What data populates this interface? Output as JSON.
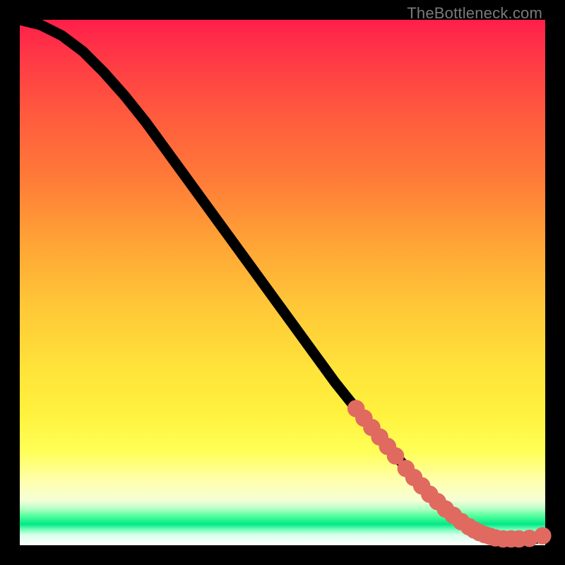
{
  "watermark": "TheBottleneck.com",
  "colors": {
    "marker": "#e06a60",
    "curve": "#000000",
    "background": "#000000"
  },
  "chart_data": {
    "type": "line",
    "title": "",
    "xlabel": "",
    "ylabel": "",
    "xlim": [
      0,
      100
    ],
    "ylim": [
      0,
      100
    ],
    "grid": false,
    "legend": false,
    "series": [
      {
        "name": "curve",
        "x": [
          0,
          4,
          8,
          12,
          16,
          20,
          24,
          28,
          32,
          36,
          40,
          44,
          48,
          52,
          56,
          60,
          64,
          68,
          72,
          76,
          80,
          83,
          85,
          88,
          90,
          92,
          94,
          96,
          98,
          100
        ],
        "y": [
          100,
          99,
          97,
          94,
          90,
          85.5,
          80.5,
          75,
          69.5,
          64,
          58.5,
          53,
          47.5,
          42,
          36.5,
          31,
          26,
          21,
          16.5,
          12,
          8,
          5.5,
          4,
          2.5,
          1.8,
          1.3,
          1.0,
          1.0,
          1.2,
          1.8
        ]
      }
    ],
    "markers": [
      {
        "x": 64.0,
        "y": 26.0
      },
      {
        "x": 65.5,
        "y": 24.2
      },
      {
        "x": 67.0,
        "y": 22.4
      },
      {
        "x": 68.5,
        "y": 20.6
      },
      {
        "x": 70.0,
        "y": 18.8
      },
      {
        "x": 71.5,
        "y": 17.0
      },
      {
        "x": 73.5,
        "y": 14.6
      },
      {
        "x": 75.0,
        "y": 12.9
      },
      {
        "x": 76.5,
        "y": 11.3
      },
      {
        "x": 78.0,
        "y": 9.7
      },
      {
        "x": 79.5,
        "y": 8.3
      },
      {
        "x": 81.0,
        "y": 6.9
      },
      {
        "x": 82.5,
        "y": 5.7
      },
      {
        "x": 84.0,
        "y": 4.5
      },
      {
        "x": 85.5,
        "y": 3.5
      },
      {
        "x": 86.5,
        "y": 2.9
      },
      {
        "x": 87.5,
        "y": 2.4
      },
      {
        "x": 88.5,
        "y": 2.0
      },
      {
        "x": 89.5,
        "y": 1.7
      },
      {
        "x": 90.5,
        "y": 1.4
      },
      {
        "x": 92.0,
        "y": 1.2
      },
      {
        "x": 93.5,
        "y": 1.2
      },
      {
        "x": 95.0,
        "y": 1.2
      },
      {
        "x": 97.0,
        "y": 1.3
      },
      {
        "x": 99.5,
        "y": 1.8
      }
    ]
  }
}
